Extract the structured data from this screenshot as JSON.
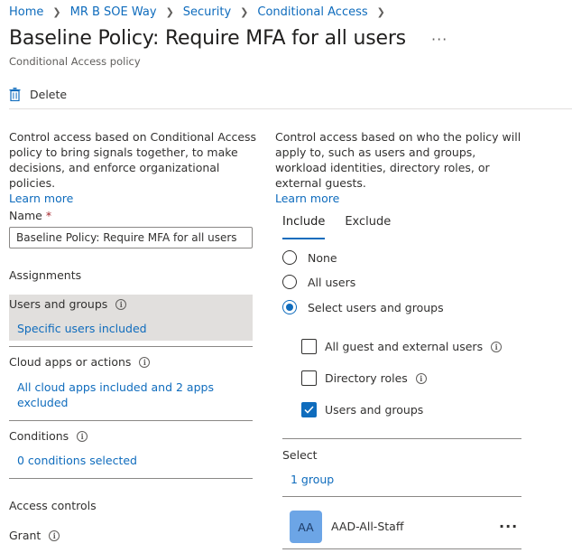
{
  "breadcrumb": [
    "Home",
    "MR B SOE Way",
    "Security",
    "Conditional Access"
  ],
  "page": {
    "title": "Baseline Policy: Require MFA for all users",
    "subtitle": "Conditional Access policy"
  },
  "toolbar": {
    "delete_label": "Delete"
  },
  "left": {
    "description": "Control access based on Conditional Access policy to bring signals together, to make decisions, and enforce organizational policies.",
    "learn_more": "Learn more",
    "name_label": "Name",
    "name_required": "*",
    "name_value": "Baseline Policy: Require MFA for all users",
    "assignments_heading": "Assignments",
    "users_title": "Users and groups",
    "users_link": "Specific users included",
    "apps_title": "Cloud apps or actions",
    "apps_link": "All cloud apps included and 2 apps excluded",
    "conditions_title": "Conditions",
    "conditions_link": "0 conditions selected",
    "access_heading": "Access controls",
    "grant_title": "Grant"
  },
  "right": {
    "description": "Control access based on who the policy will apply to, such as users and groups, workload identities, directory roles, or external guests.",
    "learn_more": "Learn more",
    "tabs": [
      {
        "label": "Include",
        "active": true
      },
      {
        "label": "Exclude",
        "active": false
      }
    ],
    "radios": [
      {
        "label": "None",
        "checked": false
      },
      {
        "label": "All users",
        "checked": false
      },
      {
        "label": "Select users and groups",
        "checked": true
      }
    ],
    "checkboxes": [
      {
        "label": "All guest and external users",
        "checked": false,
        "info": true
      },
      {
        "label": "Directory roles",
        "checked": false,
        "info": true
      },
      {
        "label": "Users and groups",
        "checked": true,
        "info": false
      }
    ],
    "select_label": "Select",
    "select_link": "1 group",
    "member": {
      "initials": "AA",
      "name": "AAD-All-Staff"
    }
  },
  "colors": {
    "accent": "#0f6cbd",
    "selected_bg": "#e1dfdd",
    "avatar_bg": "#6ca5e6",
    "required": "#a4262c"
  }
}
